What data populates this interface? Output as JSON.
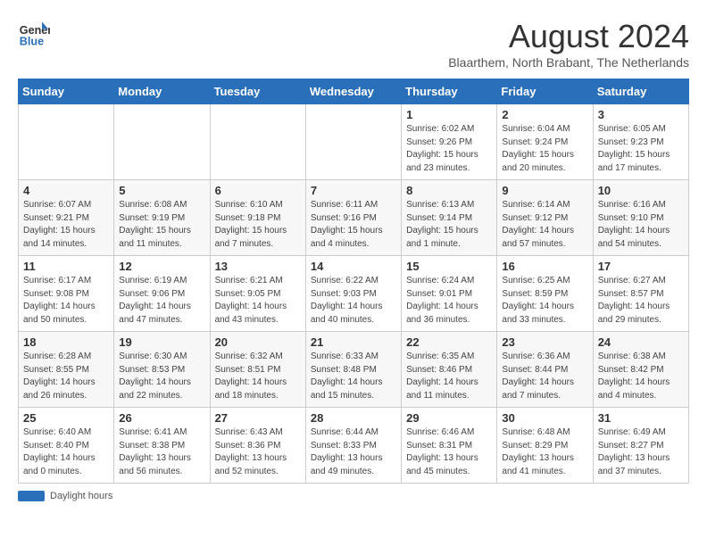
{
  "header": {
    "logo_line1": "General",
    "logo_line2": "Blue",
    "month_year": "August 2024",
    "location": "Blaarthem, North Brabant, The Netherlands"
  },
  "columns": [
    "Sunday",
    "Monday",
    "Tuesday",
    "Wednesday",
    "Thursday",
    "Friday",
    "Saturday"
  ],
  "weeks": [
    {
      "days": [
        {
          "num": "",
          "info": ""
        },
        {
          "num": "",
          "info": ""
        },
        {
          "num": "",
          "info": ""
        },
        {
          "num": "",
          "info": ""
        },
        {
          "num": "1",
          "info": "Sunrise: 6:02 AM\nSunset: 9:26 PM\nDaylight: 15 hours\nand 23 minutes."
        },
        {
          "num": "2",
          "info": "Sunrise: 6:04 AM\nSunset: 9:24 PM\nDaylight: 15 hours\nand 20 minutes."
        },
        {
          "num": "3",
          "info": "Sunrise: 6:05 AM\nSunset: 9:23 PM\nDaylight: 15 hours\nand 17 minutes."
        }
      ]
    },
    {
      "days": [
        {
          "num": "4",
          "info": "Sunrise: 6:07 AM\nSunset: 9:21 PM\nDaylight: 15 hours\nand 14 minutes."
        },
        {
          "num": "5",
          "info": "Sunrise: 6:08 AM\nSunset: 9:19 PM\nDaylight: 15 hours\nand 11 minutes."
        },
        {
          "num": "6",
          "info": "Sunrise: 6:10 AM\nSunset: 9:18 PM\nDaylight: 15 hours\nand 7 minutes."
        },
        {
          "num": "7",
          "info": "Sunrise: 6:11 AM\nSunset: 9:16 PM\nDaylight: 15 hours\nand 4 minutes."
        },
        {
          "num": "8",
          "info": "Sunrise: 6:13 AM\nSunset: 9:14 PM\nDaylight: 15 hours\nand 1 minute."
        },
        {
          "num": "9",
          "info": "Sunrise: 6:14 AM\nSunset: 9:12 PM\nDaylight: 14 hours\nand 57 minutes."
        },
        {
          "num": "10",
          "info": "Sunrise: 6:16 AM\nSunset: 9:10 PM\nDaylight: 14 hours\nand 54 minutes."
        }
      ]
    },
    {
      "days": [
        {
          "num": "11",
          "info": "Sunrise: 6:17 AM\nSunset: 9:08 PM\nDaylight: 14 hours\nand 50 minutes."
        },
        {
          "num": "12",
          "info": "Sunrise: 6:19 AM\nSunset: 9:06 PM\nDaylight: 14 hours\nand 47 minutes."
        },
        {
          "num": "13",
          "info": "Sunrise: 6:21 AM\nSunset: 9:05 PM\nDaylight: 14 hours\nand 43 minutes."
        },
        {
          "num": "14",
          "info": "Sunrise: 6:22 AM\nSunset: 9:03 PM\nDaylight: 14 hours\nand 40 minutes."
        },
        {
          "num": "15",
          "info": "Sunrise: 6:24 AM\nSunset: 9:01 PM\nDaylight: 14 hours\nand 36 minutes."
        },
        {
          "num": "16",
          "info": "Sunrise: 6:25 AM\nSunset: 8:59 PM\nDaylight: 14 hours\nand 33 minutes."
        },
        {
          "num": "17",
          "info": "Sunrise: 6:27 AM\nSunset: 8:57 PM\nDaylight: 14 hours\nand 29 minutes."
        }
      ]
    },
    {
      "days": [
        {
          "num": "18",
          "info": "Sunrise: 6:28 AM\nSunset: 8:55 PM\nDaylight: 14 hours\nand 26 minutes."
        },
        {
          "num": "19",
          "info": "Sunrise: 6:30 AM\nSunset: 8:53 PM\nDaylight: 14 hours\nand 22 minutes."
        },
        {
          "num": "20",
          "info": "Sunrise: 6:32 AM\nSunset: 8:51 PM\nDaylight: 14 hours\nand 18 minutes."
        },
        {
          "num": "21",
          "info": "Sunrise: 6:33 AM\nSunset: 8:48 PM\nDaylight: 14 hours\nand 15 minutes."
        },
        {
          "num": "22",
          "info": "Sunrise: 6:35 AM\nSunset: 8:46 PM\nDaylight: 14 hours\nand 11 minutes."
        },
        {
          "num": "23",
          "info": "Sunrise: 6:36 AM\nSunset: 8:44 PM\nDaylight: 14 hours\nand 7 minutes."
        },
        {
          "num": "24",
          "info": "Sunrise: 6:38 AM\nSunset: 8:42 PM\nDaylight: 14 hours\nand 4 minutes."
        }
      ]
    },
    {
      "days": [
        {
          "num": "25",
          "info": "Sunrise: 6:40 AM\nSunset: 8:40 PM\nDaylight: 14 hours\nand 0 minutes."
        },
        {
          "num": "26",
          "info": "Sunrise: 6:41 AM\nSunset: 8:38 PM\nDaylight: 13 hours\nand 56 minutes."
        },
        {
          "num": "27",
          "info": "Sunrise: 6:43 AM\nSunset: 8:36 PM\nDaylight: 13 hours\nand 52 minutes."
        },
        {
          "num": "28",
          "info": "Sunrise: 6:44 AM\nSunset: 8:33 PM\nDaylight: 13 hours\nand 49 minutes."
        },
        {
          "num": "29",
          "info": "Sunrise: 6:46 AM\nSunset: 8:31 PM\nDaylight: 13 hours\nand 45 minutes."
        },
        {
          "num": "30",
          "info": "Sunrise: 6:48 AM\nSunset: 8:29 PM\nDaylight: 13 hours\nand 41 minutes."
        },
        {
          "num": "31",
          "info": "Sunrise: 6:49 AM\nSunset: 8:27 PM\nDaylight: 13 hours\nand 37 minutes."
        }
      ]
    }
  ],
  "footer": {
    "daylight_label": "Daylight hours"
  }
}
